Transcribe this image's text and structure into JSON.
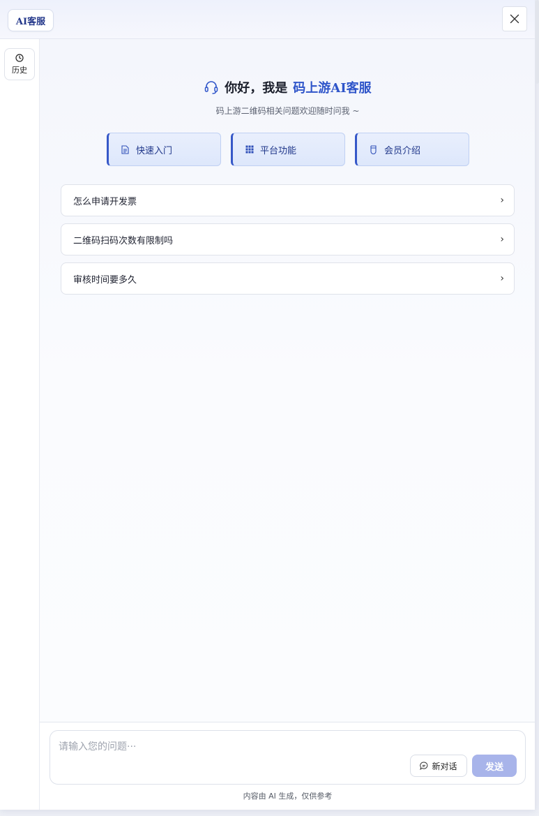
{
  "header": {
    "brand_label": "AI客服"
  },
  "sidebar": {
    "history_label": "历史"
  },
  "welcome": {
    "greeting_prefix": "你好，我是",
    "greeting_name": "码上游AI客服",
    "subtitle": "码上游二维码相关问题欢迎随时问我 ~"
  },
  "quick_actions": [
    {
      "label": "快速入门",
      "icon": "document-icon"
    },
    {
      "label": "平台功能",
      "icon": "grid-icon"
    },
    {
      "label": "会员介绍",
      "icon": "badge-icon"
    }
  ],
  "faq": [
    {
      "question": "怎么申请开发票"
    },
    {
      "question": "二维码扫码次数有限制吗"
    },
    {
      "question": "审核时间要多久"
    }
  ],
  "composer": {
    "placeholder": "请输入您的问题···",
    "new_chat_label": "新对话",
    "send_label": "发送",
    "footer_note": "内容由 AI 生成，仅供参考"
  },
  "colors": {
    "accent": "#2f55c9",
    "send_button": "#a8b4ea",
    "brand_text": "#23378a"
  }
}
